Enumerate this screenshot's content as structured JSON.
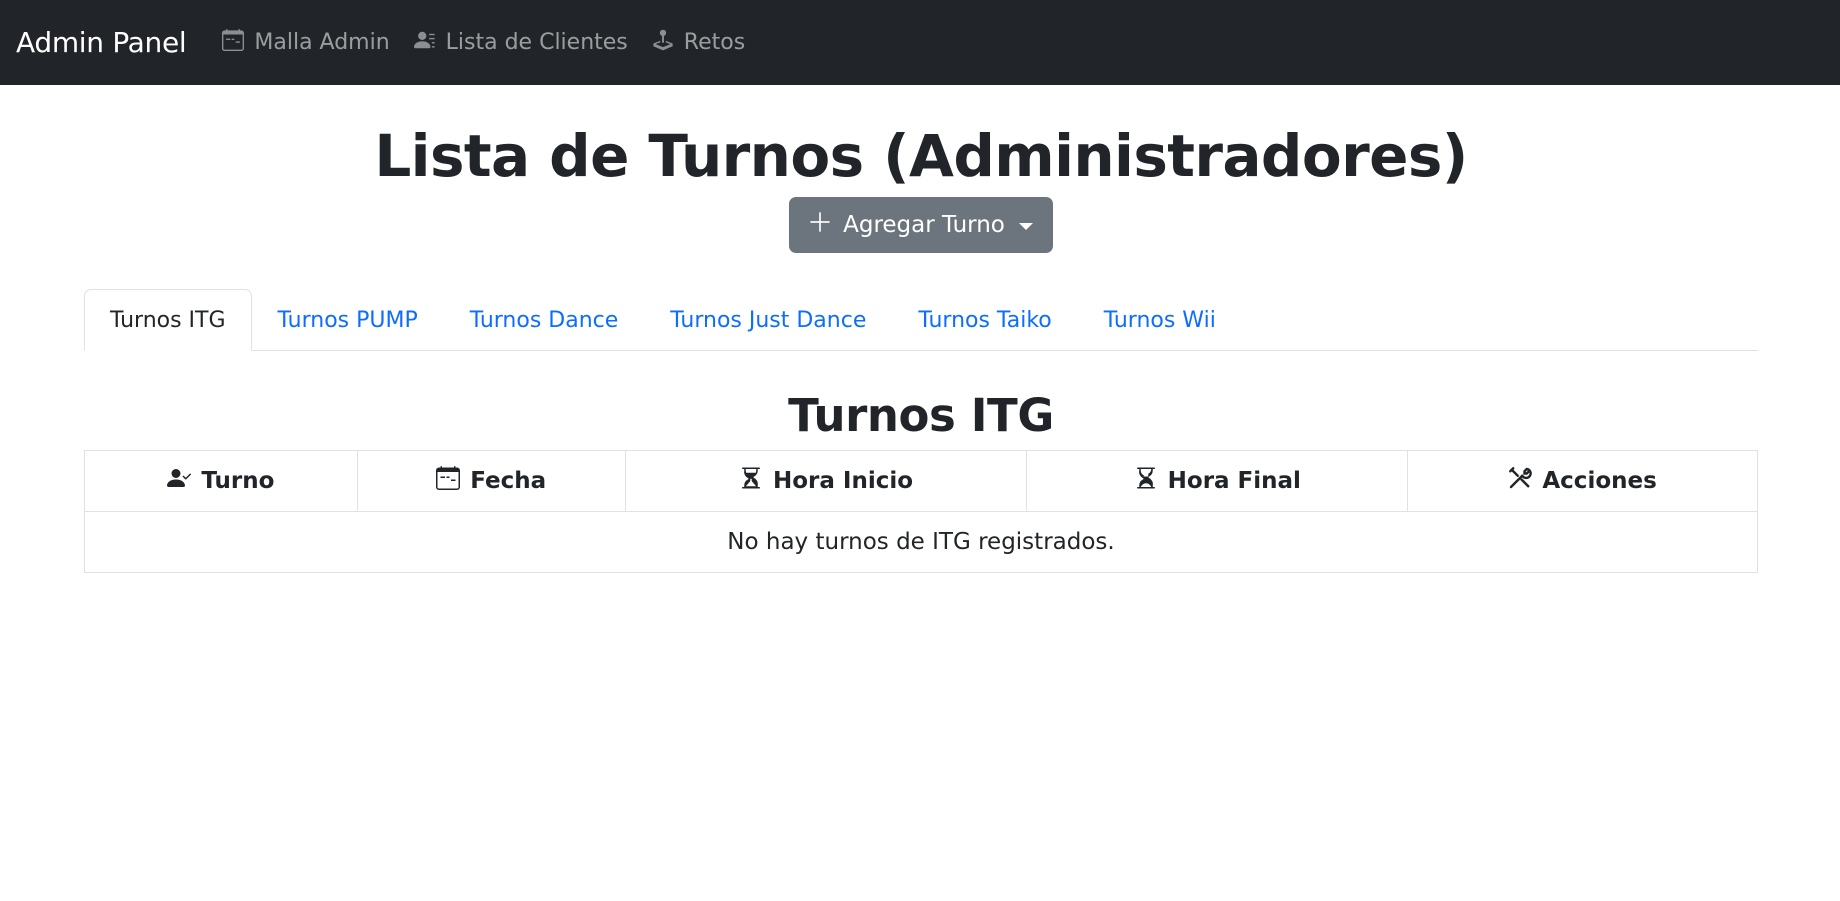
{
  "navbar": {
    "brand": "Admin Panel",
    "items": [
      {
        "label": "Malla Admin",
        "icon": "calendar-icon"
      },
      {
        "label": "Lista de Clientes",
        "icon": "person-lines-icon"
      },
      {
        "label": "Retos",
        "icon": "joystick-icon"
      }
    ]
  },
  "main": {
    "title": "Lista de Turnos (Administradores)",
    "add_button": {
      "label": "Agregar Turno",
      "icon": "plus-icon"
    },
    "tabs": [
      {
        "label": "Turnos ITG",
        "active": true
      },
      {
        "label": "Turnos PUMP",
        "active": false
      },
      {
        "label": "Turnos Dance",
        "active": false
      },
      {
        "label": "Turnos Just Dance",
        "active": false
      },
      {
        "label": "Turnos Taiko",
        "active": false
      },
      {
        "label": "Turnos Wii",
        "active": false
      }
    ],
    "section_title": "Turnos ITG",
    "table": {
      "columns": [
        {
          "label": "Turno",
          "icon": "person-check-icon"
        },
        {
          "label": "Fecha",
          "icon": "calendar-icon"
        },
        {
          "label": "Hora Inicio",
          "icon": "hourglass-top-icon"
        },
        {
          "label": "Hora Final",
          "icon": "hourglass-bottom-icon"
        },
        {
          "label": "Acciones",
          "icon": "tools-icon"
        }
      ],
      "empty_message": "No hay turnos de ITG registrados."
    }
  },
  "colors": {
    "navbar_bg": "#212529",
    "nav_link": "#8c8f92",
    "tab_link": "#0d6efd",
    "button_bg": "#6c757d",
    "border": "#dee2e6"
  }
}
